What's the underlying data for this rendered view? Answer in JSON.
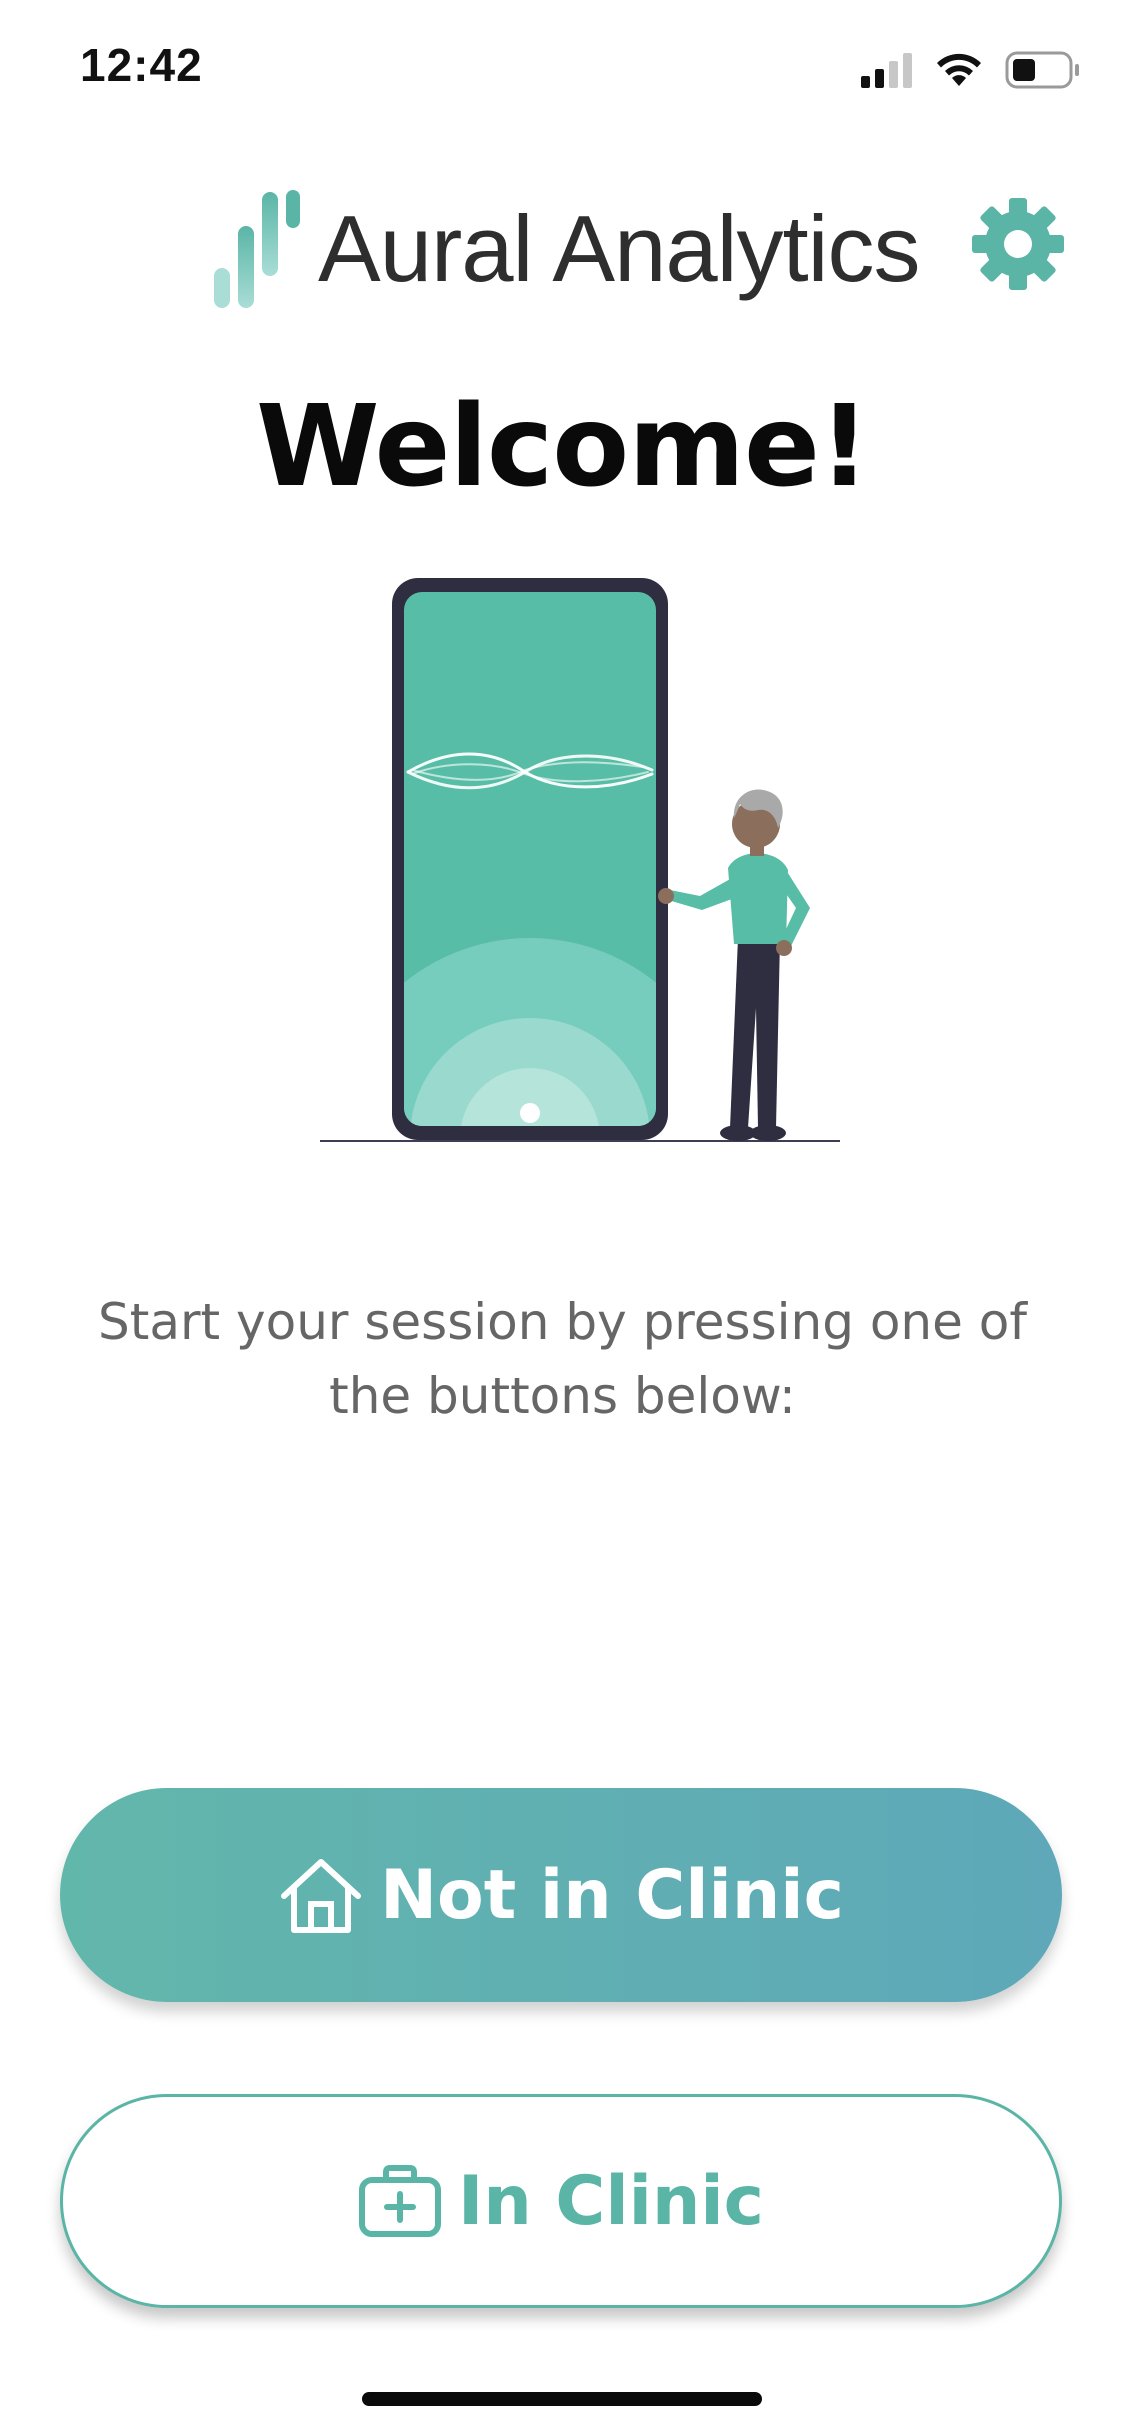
{
  "status_bar": {
    "time": "12:42",
    "signal_icon": "cellular-signal-icon",
    "wifi_icon": "wifi-icon",
    "battery_icon": "battery-icon"
  },
  "header": {
    "brand_name": "Aural Analytics",
    "logo_icon": "aural-analytics-logo-icon",
    "settings_icon": "gear-icon"
  },
  "welcome": {
    "title": "Welcome!"
  },
  "illustration": {
    "description_icon": "person-beside-phone-illustration"
  },
  "instruction": {
    "text": "Start your session by pressing one of the buttons below:"
  },
  "buttons": {
    "not_in_clinic": {
      "label": "Not in Clinic",
      "icon": "home-icon"
    },
    "in_clinic": {
      "label": "In Clinic",
      "icon": "medical-kit-icon"
    }
  },
  "colors": {
    "accent": "#5ab5a6",
    "gradient_start": "#62b7ab",
    "gradient_end": "#5ea8b9",
    "text_muted": "#666666",
    "phone_screen": "#58bda6",
    "phone_frame": "#2f2e41"
  }
}
